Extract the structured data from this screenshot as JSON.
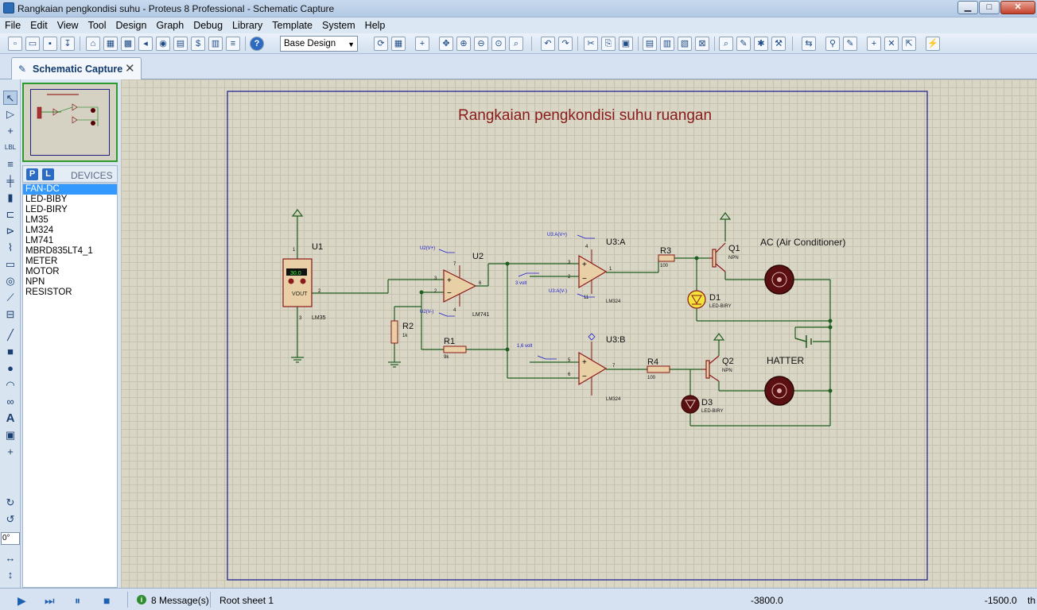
{
  "window": {
    "title": "Rangkaian pengkondisi suhu - Proteus 8 Professional - Schematic Capture",
    "min_label": "▁",
    "max_label": "□",
    "close_label": "✕"
  },
  "menu": [
    "File",
    "Edit",
    "View",
    "Tool",
    "Design",
    "Graph",
    "Debug",
    "Library",
    "Template",
    "System",
    "Help"
  ],
  "toolbar": {
    "design_select_value": "Base Design"
  },
  "tabs": [
    {
      "label": "Schematic Capture",
      "close": "✕"
    }
  ],
  "left_panel": {
    "pick_button": "P",
    "library_button": "L",
    "devices_title": "DEVICES",
    "devices": [
      "FAN-DC",
      "LED-BIBY",
      "LED-BIRY",
      "LM35",
      "LM324",
      "LM741",
      "MBRD835LT4_1",
      "METER",
      "MOTOR",
      "NPN",
      "RESISTOR"
    ],
    "selected_device": "FAN-DC",
    "rotation_value": "0°"
  },
  "schematic": {
    "title": "Rangkaian pengkondisi suhu ruangan",
    "labels": {
      "u1": "U1",
      "u1_pin1": "1",
      "u1_pin2": "2",
      "u1_pin3": "3",
      "u1_display": "30.0",
      "u1_vout": "VOUT",
      "u1_part": "LM35",
      "u2": "U2",
      "u2_part": "LM741",
      "u2_pin3": "3",
      "u2_pin2": "2",
      "u2_pin6": "6",
      "u2_pin7": "7",
      "u2_pin4": "4",
      "u2_vplus": "U2(V+)",
      "u2_vminus": "U2(V-)",
      "r1": "R1",
      "r1_val": "9k",
      "r2": "R2",
      "r2_val": "1k",
      "u3a": "U3:A",
      "u3a_part": "LM324",
      "u3a_vplus": "U3:A(V+)",
      "u3a_vminus": "U3:A(V-)",
      "u3a_pin3": "3",
      "u3a_pin2": "2",
      "u3a_pin1": "1",
      "u3a_pin4": "4",
      "u3a_pin11": "11",
      "u3b": "U3:B",
      "u3b_part": "LM324",
      "u3b_pin5": "5",
      "u3b_pin6": "6",
      "u3b_pin7": "7",
      "ref_3volt": "3 volt",
      "ref_16volt": "1,6 volt",
      "r3": "R3",
      "r3_val": "100",
      "r4": "R4",
      "r4_val": "100",
      "q1": "Q1",
      "q1_type": "NPN",
      "q2": "Q2",
      "q2_type": "NPN",
      "d1": "D1",
      "d1_part": "LED-BIRY",
      "d3": "D3",
      "d3_part": "LED-BIRY",
      "ac": "AC (Air Conditioner)",
      "hatter": "HATTER"
    }
  },
  "status": {
    "messages": "8 Message(s)",
    "sheet": "Root sheet 1",
    "x": "-3800.0",
    "y": "-1500.0",
    "unit": "th"
  }
}
